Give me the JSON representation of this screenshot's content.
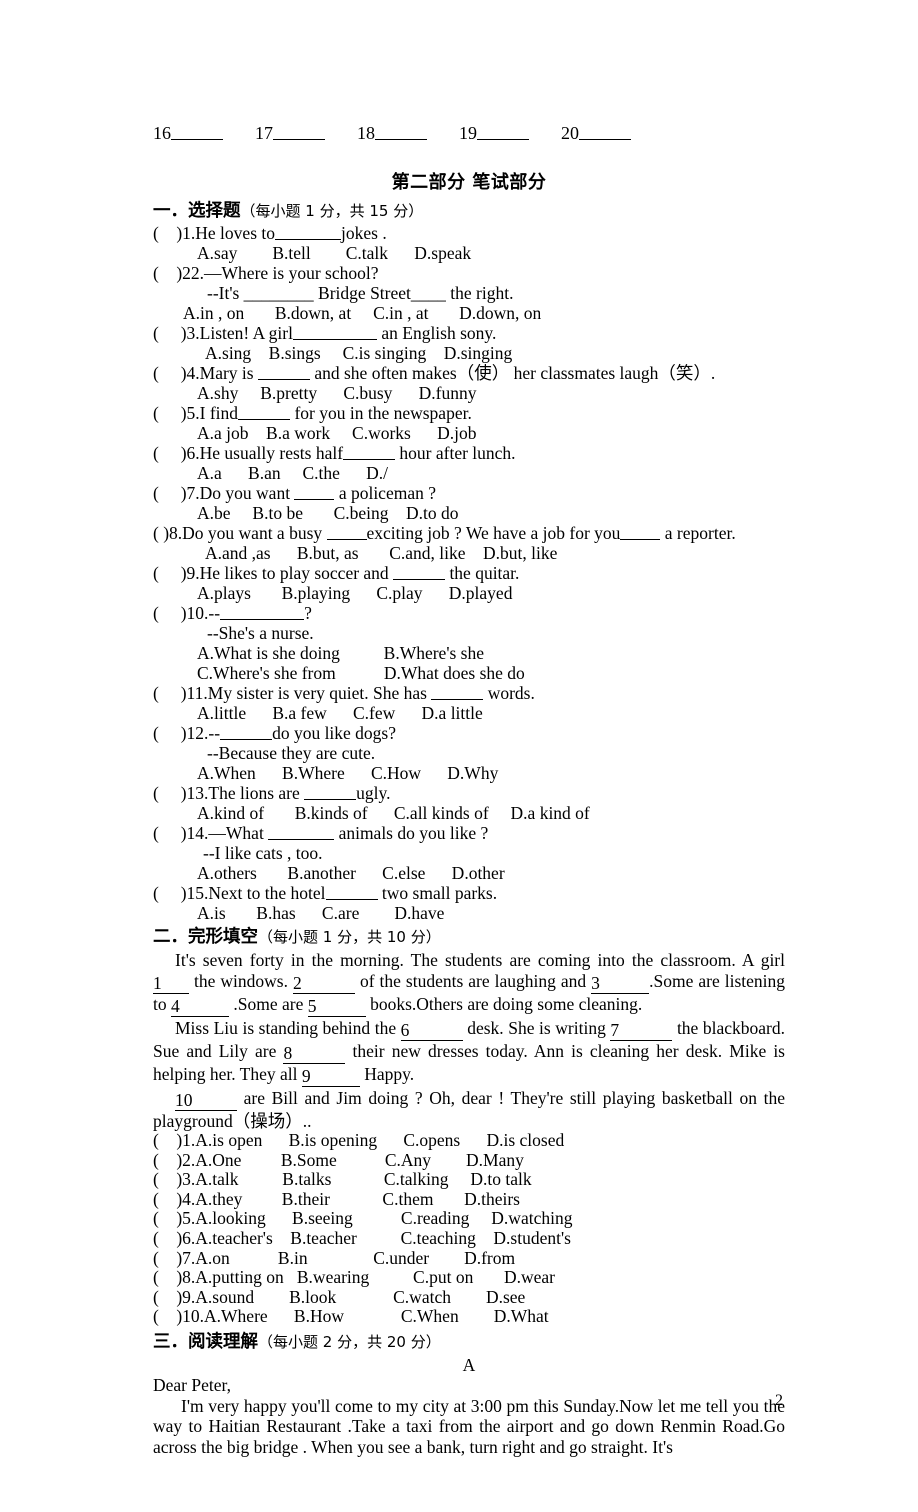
{
  "document": {
    "page_number": "2",
    "part_heading": "第二部分  笔试部分"
  },
  "answer_blanks_top": {
    "name": "listening-answer-blanks",
    "numbers": [
      "16",
      "17",
      "18",
      "19",
      "20"
    ]
  },
  "section_one": {
    "label": "一．",
    "title": "选择题",
    "score_note": "（每小题 1 分，共 15 分）",
    "questions": [
      {
        "num": "1",
        "stem_before": ")1.He loves to",
        "stem_after": "jokes .",
        "options": "A.say        B.tell        C.talk      D.speak"
      },
      {
        "num": "22",
        "stem_before": ")22.—Where is your school?",
        "sub": "--It's ________ Bridge Street____ the right.",
        "options": "A.in , on       B.down, at     C.in , at       D.down, on"
      },
      {
        "num": "3",
        "stem_before": ")3.Listen! A girl",
        "stem_after": "an English sony.",
        "options": "A.sing    B.sings     C.is singing    D.singing"
      },
      {
        "num": "4",
        "stem_before": ")4.Mary is",
        "stem_after": "and she often makes（使） her classmates laugh（笑）.",
        "options": "A.shy     B.pretty      C.busy      D.funny"
      },
      {
        "num": "5",
        "stem_before": ")5.I find",
        "stem_after": "for you in the newspaper.",
        "options": "A.a job    B.a work     C.works      D.job"
      },
      {
        "num": "6",
        "stem_before": ")6.He usually rests half",
        "stem_after": "hour after lunch.",
        "options": "A.a      B.an     C.the      D./"
      },
      {
        "num": "7",
        "stem_before": ")7.Do you want",
        "stem_after": "a policeman ?",
        "options": "A.be     B.to be       C.being    D.to do"
      },
      {
        "num": "8",
        "stem_part1": ")8.Do you want a busy ",
        "stem_part2": "exciting job ? We have a job for you",
        "stem_part3": " a reporter.",
        "options": "A.and ,as      B.but, as       C.and, like    D.but, like"
      },
      {
        "num": "9",
        "stem_before": ")9.He likes to play soccer and",
        "stem_after": "the quitar.",
        "options": "A.plays       B.playing      C.play      D.played"
      },
      {
        "num": "10",
        "stem_before": ")10.--",
        "stem_after": "?",
        "sub": "--She's a nurse.",
        "options_a": "A.What is she doing          B.Where's she",
        "options_b": "C.Where's she from           D.What does she do"
      },
      {
        "num": "11",
        "stem_before": ")11.My sister is very quiet. She has",
        "stem_after": "words.",
        "options": "A.little      B.a few      C.few      D.a little"
      },
      {
        "num": "12",
        "stem_before": ")12.--",
        "stem_after": "do you like dogs?",
        "sub": "--Because they are cute.",
        "options": "A.When      B.Where      C.How      D.Why"
      },
      {
        "num": "13",
        "stem_before": ")13.The lions are",
        "stem_after": "ugly.",
        "options": "A.kind of       B.kinds of      C.all kinds of     D.a kind of"
      },
      {
        "num": "14",
        "stem_before": ")14.—What",
        "stem_after": "animals do you like ?",
        "sub": "--I like cats , too.",
        "options": "A.others       B.another      C.else      D.other"
      },
      {
        "num": "15",
        "stem_before": ")15.Next to the hotel",
        "stem_after": "two small parks.",
        "options": "A.is       B.has      C.are        D.have"
      }
    ]
  },
  "section_two": {
    "label": "二．",
    "title": "完形填空",
    "score_note": "（每小题 1 分，共 10 分）",
    "passage": {
      "p1_a": "It's seven forty in the morning. The students are coming into the classroom. A girl ",
      "blank1": "1",
      "p1_b": " the windows. ",
      "blank2": "2",
      "p1_c": " of the students are laughing and ",
      "blank3": "3",
      "p1_d": ".Some are listening to ",
      "blank4": "4",
      "p1_e": " .Some are ",
      "blank5": "5",
      "p1_f": " books.Others are doing some cleaning.",
      "p2_a": "Miss Liu is standing behind the ",
      "blank6": "6",
      "p2_b": " desk. She is writing ",
      "blank7": "7",
      "p2_c": " the blackboard. Sue and Lily are ",
      "blank8": "8",
      "p2_d": " their new dresses today. Ann is cleaning her desk. Mike is helping her. They all ",
      "blank9": "9",
      "p2_e": " Happy.",
      "p3_a": "",
      "blank10": "10",
      "p3_b": " are Bill and Jim doing ? Oh, dear ! They're still playing basketball on the playground（操场）.."
    },
    "options": [
      ")1.A.is open      B.is opening      C.opens      D.is closed",
      ")2.A.One         B.Some           C.Any        D.Many",
      ")3.A.talk          B.talks            C.talking     D.to talk",
      ")4.A.they         B.their            C.them       D.theirs",
      ")5.A.looking      B.seeing           C.reading     D.watching",
      ")6.A.teacher's    B.teacher          C.teaching    D.student's",
      ")7.A.on           B.in               C.under        D.from",
      ")8.A.putting on   B.wearing          C.put on       D.wear",
      ")9.A.sound        B.look             C.watch        D.see",
      ")10.A.Where      B.How             C.When        D.What"
    ]
  },
  "section_three": {
    "label": "三．",
    "title": "阅读理解",
    "score_note": "（每小题 2 分，共 20 分）",
    "passage_label": "A",
    "salutation": "Dear Peter,",
    "body": "I'm very happy you'll come to my city at 3:00 pm this Sunday.Now let me tell you the way to Haitian Restaurant .Take a taxi from the airport and go down Renmin Road.Go across the big bridge . When you see a bank, turn right and go straight. It's"
  }
}
